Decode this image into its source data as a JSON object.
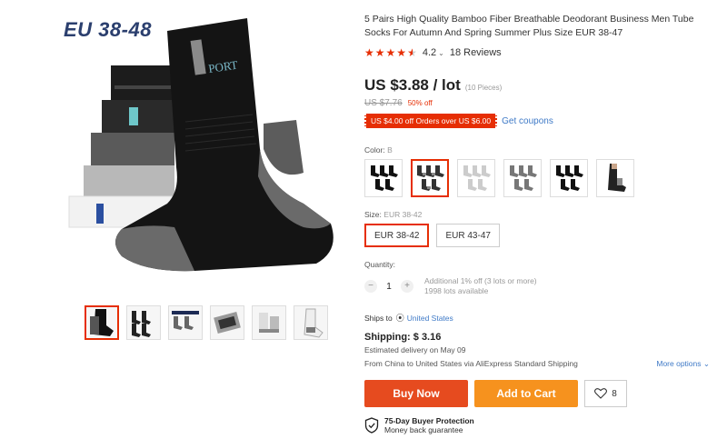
{
  "product": {
    "badge": "EU 38-48",
    "title": "5 Pairs High Quality Bamboo Fiber Breathable Deodorant Business Men Tube Socks For Autumn And Spring Summer Plus Size EUR 38-47",
    "rating": {
      "value": "4.2",
      "stars": 4.2,
      "reviews": "18 Reviews"
    },
    "price": "US $3.88 / lot",
    "pieces": "(10 Pieces)",
    "old_price": "US $7.76",
    "discount": "50% off",
    "coupon": "US $4.00 off Orders over US $6.00",
    "get_coupons": "Get coupons"
  },
  "color": {
    "label": "Color:",
    "selected": "B",
    "swatches": [
      "black-socks",
      "black-grey-socks",
      "white-grey-socks",
      "mixed-socks",
      "black-socks-2",
      "model-socks"
    ]
  },
  "size": {
    "label": "Size:",
    "selected": "EUR 38-42",
    "options": [
      "EUR 38-42",
      "EUR 43-47"
    ]
  },
  "quantity": {
    "label": "Quantity:",
    "value": "1",
    "minus": "−",
    "plus": "+",
    "info_1": "Additional 1% off (3 lots or more)",
    "info_2": "1998 lots available"
  },
  "shipping": {
    "ships_to_label": "Ships to",
    "country": "United States",
    "title": "Shipping: $ 3.16",
    "delivery": "Estimated delivery on May 09",
    "route": "From China to United States via AliExpress Standard Shipping",
    "more_options": "More options ⌄"
  },
  "actions": {
    "buy_now": "Buy Now",
    "add_to_cart": "Add to Cart",
    "wish_count": "8"
  },
  "protection": {
    "title": "75-Day Buyer Protection",
    "subtitle": "Money back guarantee"
  },
  "colors": {
    "accent": "#e62e04",
    "link": "#3f7ac7",
    "buy": "#e64b1f",
    "cart": "#f6921e"
  }
}
